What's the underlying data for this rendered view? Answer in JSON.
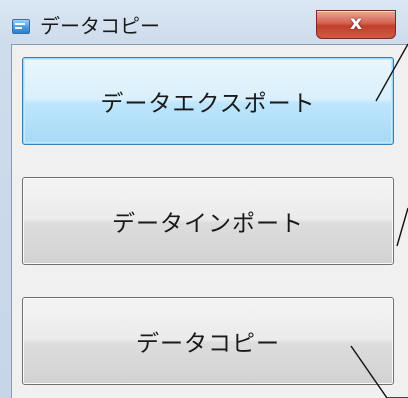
{
  "window": {
    "title": "データコピー",
    "close_label": "x"
  },
  "buttons": {
    "export_label": "データエクスポート",
    "import_label": "データインポート",
    "copy_label": "データコピー"
  }
}
